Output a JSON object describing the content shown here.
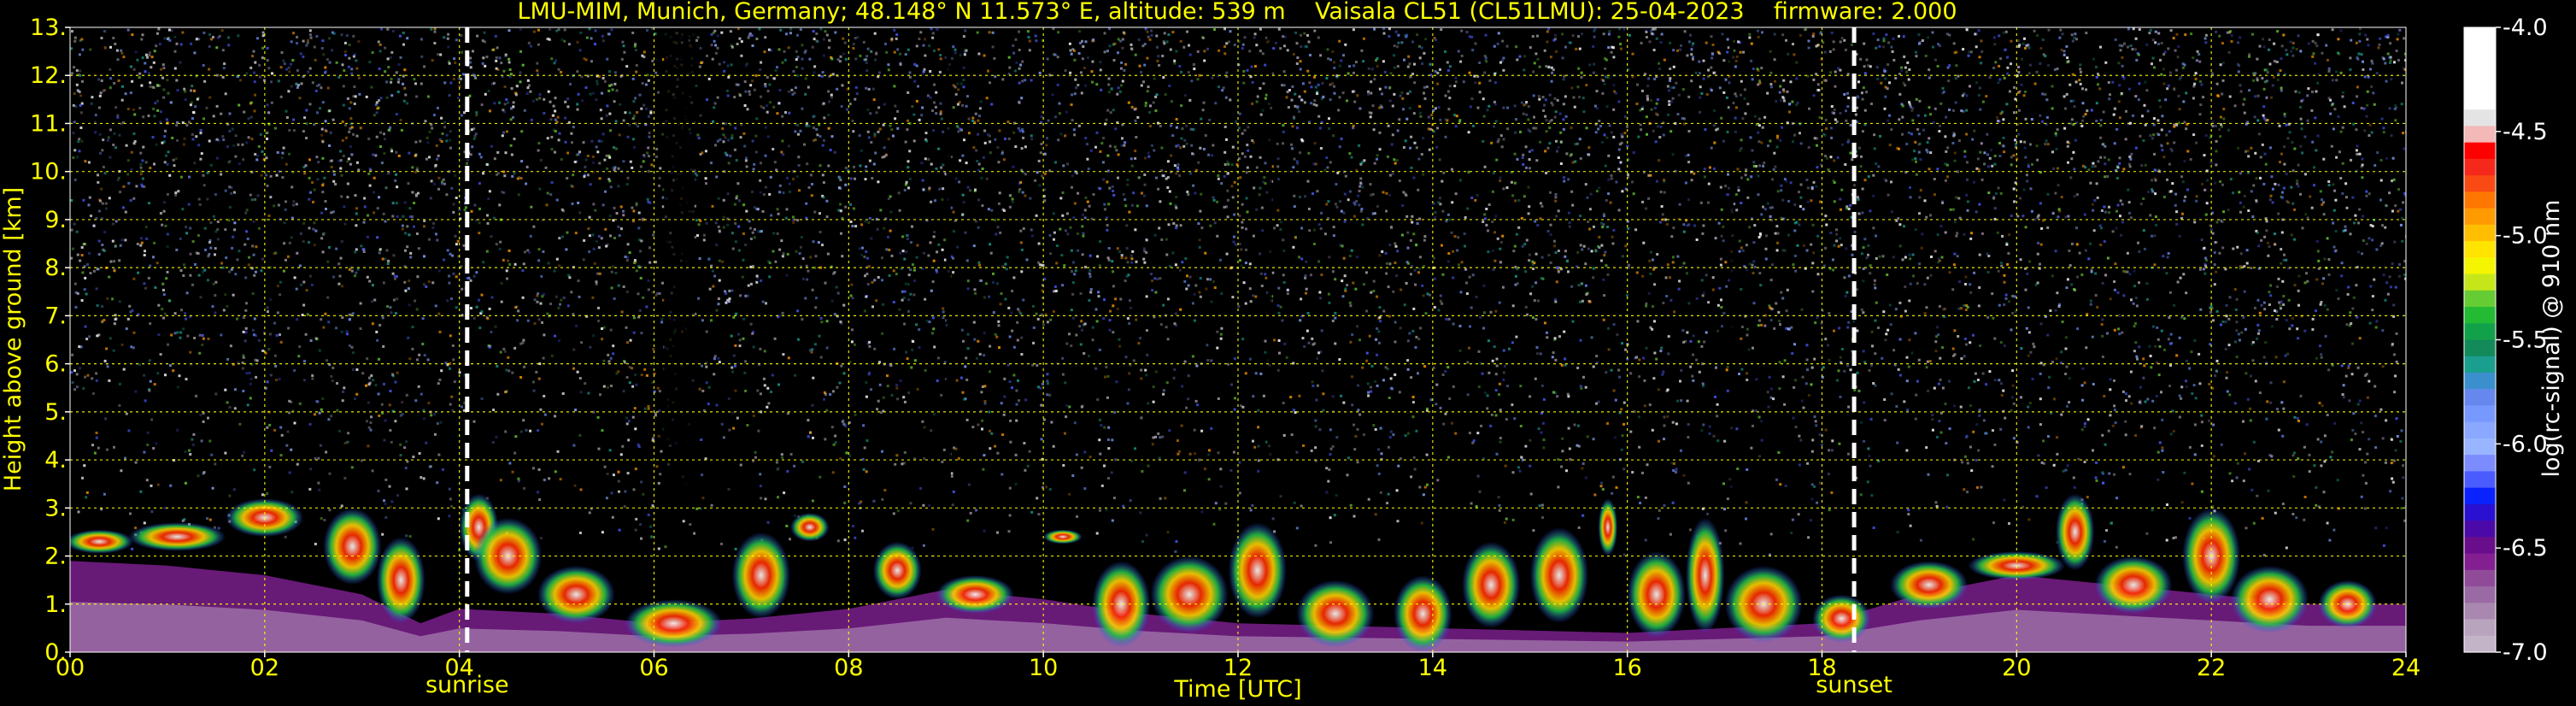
{
  "chart_data": {
    "type": "heatmap",
    "title": "LMU-MIM, Munich, Germany; 48.148° N 11.573° E, altitude: 539 m    Vaisala CL51 (CL51LMU): 25-04-2023    firmware: 2.000",
    "xlabel": "Time [UTC]",
    "ylabel": "Height above ground [km]",
    "xlim": [
      0,
      24
    ],
    "ylim": [
      0,
      13
    ],
    "x_ticks": [
      0,
      2,
      4,
      6,
      8,
      10,
      12,
      14,
      16,
      18,
      20,
      22,
      24
    ],
    "x_tick_labels": [
      "00",
      "02",
      "04",
      "06",
      "08",
      "10",
      "12",
      "14",
      "16",
      "18",
      "20",
      "22",
      "24"
    ],
    "y_ticks": [
      0,
      1,
      2,
      3,
      4,
      5,
      6,
      7,
      8,
      9,
      10,
      11,
      12,
      13
    ],
    "y_tick_labels": [
      "0.",
      "1.",
      "2.",
      "3.",
      "4.",
      "5.",
      "6.",
      "7.",
      "8.",
      "9.",
      "10.",
      "11.",
      "12.",
      "13."
    ],
    "grid": true,
    "annotations": [
      {
        "label": "sunrise",
        "x": 4.08
      },
      {
        "label": "sunset",
        "x": 18.33
      }
    ],
    "colorbar": {
      "label": "log(rc-signal) @ 910 nm",
      "min": -7.0,
      "max": -4.0,
      "ticks": [
        -4.0,
        -4.5,
        -5.0,
        -5.5,
        -6.0,
        -6.5,
        -7.0
      ],
      "tick_labels": [
        "-4.0",
        "-4.5",
        "-5.0",
        "-5.5",
        "-6.0",
        "-6.5",
        "-7.0"
      ],
      "palette_top_to_bottom": [
        "#ffffff",
        "#ffffff",
        "#ffffff",
        "#ffffff",
        "#ffffff",
        "#e4e4e4",
        "#f3b8b8",
        "#ff0000",
        "#f5281c",
        "#f94a14",
        "#ff7700",
        "#ff9a00",
        "#ffbf00",
        "#ffe400",
        "#f5f500",
        "#c6e61a",
        "#66cc33",
        "#22bb33",
        "#11a14a",
        "#138a5a",
        "#1a9e8e",
        "#3a8fcc",
        "#6688ee",
        "#7799ff",
        "#8aa8ff",
        "#99b5ff",
        "#7c8cff",
        "#4a5cff",
        "#0a22ff",
        "#2a10d0",
        "#4b0aa8",
        "#6a0d8a",
        "#831f91",
        "#8f4b98",
        "#9a6aa4",
        "#a888ae",
        "#b8a4bd",
        "#c4b4c8"
      ]
    },
    "colors": {
      "text": "#ffff00",
      "grid": "#ffff00",
      "background": "#000000",
      "colorbar_text": "#ffffff"
    }
  }
}
